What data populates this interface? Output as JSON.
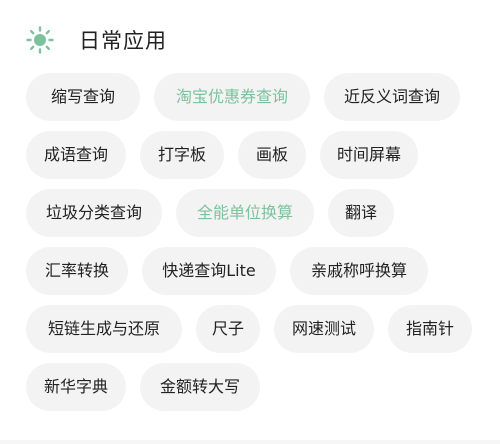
{
  "section": {
    "icon": "sun-icon",
    "title": "日常应用"
  },
  "colors": {
    "accent": "#7cc29b",
    "chip_background": "#f3f3f3",
    "text": "#222222"
  },
  "tools": [
    [
      {
        "label": "缩写查询",
        "highlighted": false
      },
      {
        "label": "淘宝优惠券查询",
        "highlighted": true
      },
      {
        "label": "近反义词查询",
        "highlighted": false
      }
    ],
    [
      {
        "label": "成语查询",
        "highlighted": false
      },
      {
        "label": "打字板",
        "highlighted": false
      },
      {
        "label": "画板",
        "highlighted": false
      },
      {
        "label": "时间屏幕",
        "highlighted": false
      }
    ],
    [
      {
        "label": "垃圾分类查询",
        "highlighted": false
      },
      {
        "label": "全能单位换算",
        "highlighted": true
      },
      {
        "label": "翻译",
        "highlighted": false
      }
    ],
    [
      {
        "label": "汇率转换",
        "highlighted": false
      },
      {
        "label": "快递查询Lite",
        "highlighted": false
      },
      {
        "label": "亲戚称呼换算",
        "highlighted": false
      }
    ],
    [
      {
        "label": "短链生成与还原",
        "highlighted": false
      },
      {
        "label": "尺子",
        "highlighted": false
      },
      {
        "label": "网速测试",
        "highlighted": false
      },
      {
        "label": "指南针",
        "highlighted": false
      }
    ],
    [
      {
        "label": "新华字典",
        "highlighted": false
      },
      {
        "label": "金额转大写",
        "highlighted": false
      }
    ]
  ]
}
